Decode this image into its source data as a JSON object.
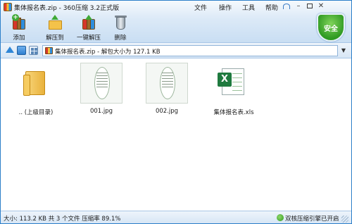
{
  "window": {
    "title": "集体报名表.zip - 360压缩 3.2正式版"
  },
  "menu": {
    "items": [
      "文件",
      "操作",
      "工具",
      "帮助"
    ]
  },
  "toolbar": {
    "add_label": "添加",
    "extract_label": "解压到",
    "oneclick_label": "一键解压",
    "delete_label": "删除"
  },
  "security": {
    "label": "安全",
    "color": "#2f9a22"
  },
  "addressbar": {
    "path": "集体报名表.zip - 解包大小为 127.1 KB"
  },
  "files": [
    {
      "name": ".. (上级目录)",
      "type": "folder-up"
    },
    {
      "name": "001.jpg",
      "type": "image"
    },
    {
      "name": "002.jpg",
      "type": "image"
    },
    {
      "name": "集体报名表.xls",
      "type": "excel"
    }
  ],
  "statusbar": {
    "info": "大小: 113.2 KB 共 3 个文件 压缩率 89.1%",
    "right": "双核压缩引擎已开启"
  },
  "colors": {
    "accent": "#2c7fc9",
    "toolbar_bg": "#dbe9f7",
    "excel_green": "#1f7a3f"
  }
}
